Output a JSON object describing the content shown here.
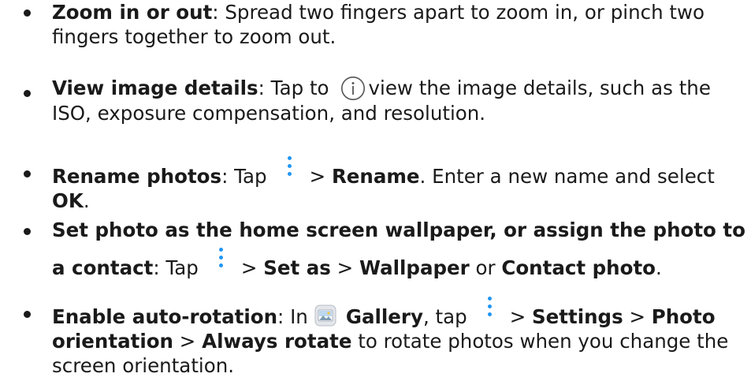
{
  "bullets": {
    "zoom": {
      "title": "Zoom in or out",
      "text": ": Spread two fingers apart to zoom in, or pinch two fingers together to zoom out."
    },
    "details": {
      "title": "View image details",
      "pre": ": Tap to",
      "post": "view the image details, such as the ISO, exposure compensation, and resolution."
    },
    "rename": {
      "title": "Rename photos",
      "pre": ": Tap",
      "sep1": "> ",
      "menu": "Rename",
      "post": ". Enter a new name and select ",
      "ok": "OK",
      "end": "."
    },
    "wallpaper": {
      "title": "Set photo as the home screen wallpaper, or assign the photo to a contact",
      "pre": ": Tap",
      "sep1": "> ",
      "setas": "Set as",
      "sep2": " > ",
      "wallpaper": "Wallpaper",
      "or": " or ",
      "contact": "Contact photo",
      "end": "."
    },
    "rotation": {
      "title": "Enable auto-rotation",
      "pre": ": In",
      "gallery": "Gallery",
      "tap": ", tap",
      "sep1": "> ",
      "settings": "Settings",
      "sep2": " > ",
      "orientation": "Photo orientation",
      "sep3": " > ",
      "always": "Always rotate",
      "post": " to rotate photos when you change the screen orientation."
    }
  },
  "icons": {
    "info": "info-icon",
    "more": "more-options-icon",
    "gallery": "gallery-app-icon",
    "more_color": "#2196f3"
  }
}
